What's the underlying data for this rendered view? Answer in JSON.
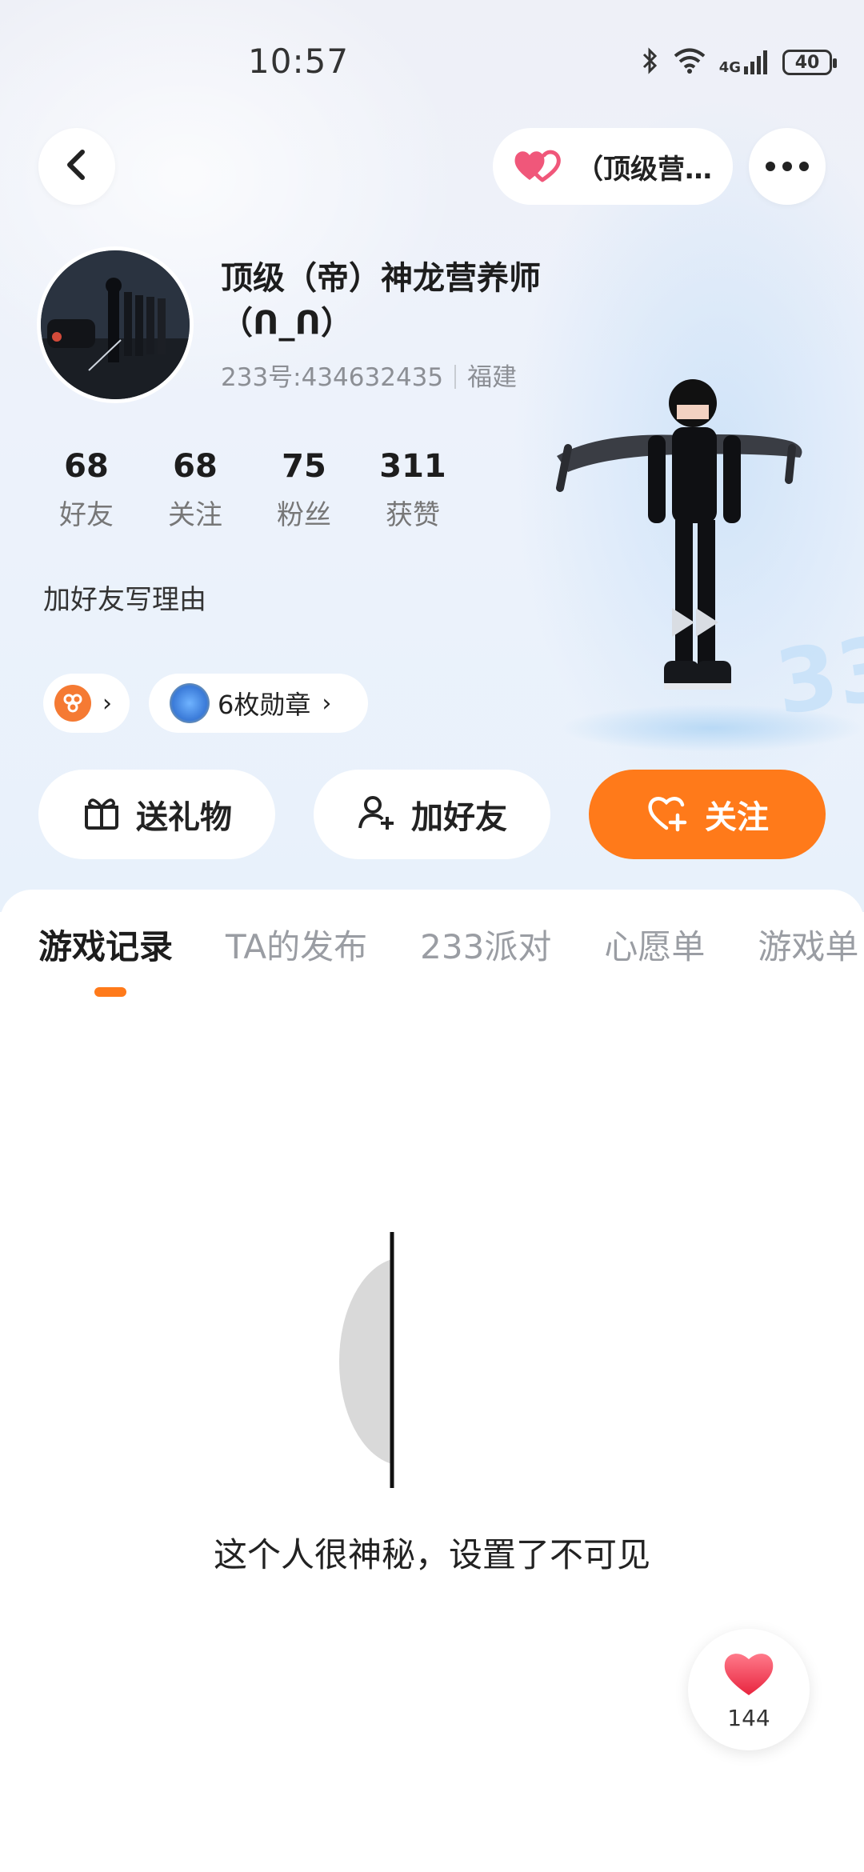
{
  "status_bar": {
    "time": "10:57",
    "network": "4G",
    "battery": "40",
    "icons": [
      "bluetooth-icon",
      "wifi-icon",
      "signal-icon",
      "battery-icon"
    ]
  },
  "header": {
    "back_icon": "chevron-left-icon",
    "pill_label": "（顶级营…",
    "more_icon": "more-dots-icon"
  },
  "profile": {
    "name_line1": "顶级（帝）神龙营养师",
    "name_line2": "（ᑎ_ᑎ）",
    "id_text": "233号:434632435",
    "location": "福建",
    "bio": "加好友写理由"
  },
  "stats": [
    {
      "value": "68",
      "label": "好友"
    },
    {
      "value": "68",
      "label": "关注"
    },
    {
      "value": "75",
      "label": "粉丝"
    },
    {
      "value": "311",
      "label": "获赞"
    }
  ],
  "chips": {
    "badge_count_label": "6枚勋章"
  },
  "actions": {
    "gift": "送礼物",
    "add_friend": "加好友",
    "follow": "关注"
  },
  "tabs": [
    {
      "label": "游戏记录",
      "active": true
    },
    {
      "label": "TA的发布",
      "active": false
    },
    {
      "label": "233派对",
      "active": false
    },
    {
      "label": "心愿单",
      "active": false
    },
    {
      "label": "游戏单",
      "active": false
    }
  ],
  "empty_state": {
    "message": "这个人很神秘，设置了不可见"
  },
  "like_fab": {
    "count": "144"
  },
  "colors": {
    "accent": "#ff7a1a",
    "heart": "#f0455f",
    "text_primary": "#1d1d1d",
    "text_secondary": "#8c8f95"
  }
}
